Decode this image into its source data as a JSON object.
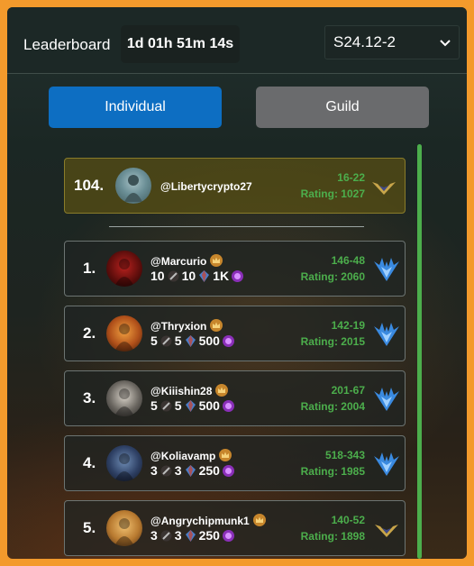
{
  "header": {
    "title": "Leaderboard",
    "timer": "1d 01h 51m 14s",
    "season": "S24.12-2"
  },
  "tabs": [
    {
      "label": "Individual",
      "active": true
    },
    {
      "label": "Guild",
      "active": false
    }
  ],
  "self": {
    "rank": "104.",
    "username": "@Libertycrypto27",
    "record": "16-22",
    "rating": "Rating: 1027",
    "emblem": "gold-wings-icon"
  },
  "entries": [
    {
      "rank": "1.",
      "username": "@Marcurio",
      "stat_a": "10",
      "stat_b": "10",
      "stat_c": "1K",
      "record": "146-48",
      "rating": "Rating: 2060",
      "emblem": "blue-wings-icon"
    },
    {
      "rank": "2.",
      "username": "@Thryxion",
      "stat_a": "5",
      "stat_b": "5",
      "stat_c": "500",
      "record": "142-19",
      "rating": "Rating: 2015",
      "emblem": "blue-wings-icon"
    },
    {
      "rank": "3.",
      "username": "@Kiiishin28",
      "stat_a": "5",
      "stat_b": "5",
      "stat_c": "500",
      "record": "201-67",
      "rating": "Rating: 2004",
      "emblem": "blue-wings-icon"
    },
    {
      "rank": "4.",
      "username": "@Koliavamp",
      "stat_a": "3",
      "stat_b": "3",
      "stat_c": "250",
      "record": "518-343",
      "rating": "Rating: 1985",
      "emblem": "blue-wings-icon"
    },
    {
      "rank": "5.",
      "username": "@Angrychipmunk1",
      "stat_a": "3",
      "stat_b": "3",
      "stat_c": "250",
      "record": "140-52",
      "rating": "Rating: 1898",
      "emblem": "gold-wings-icon"
    }
  ],
  "colors": {
    "accent_blue": "#0d6ec2",
    "inactive_tab": "#6a6b6d",
    "rating_green": "#4cae4c",
    "self_highlight": "#5a5014"
  }
}
